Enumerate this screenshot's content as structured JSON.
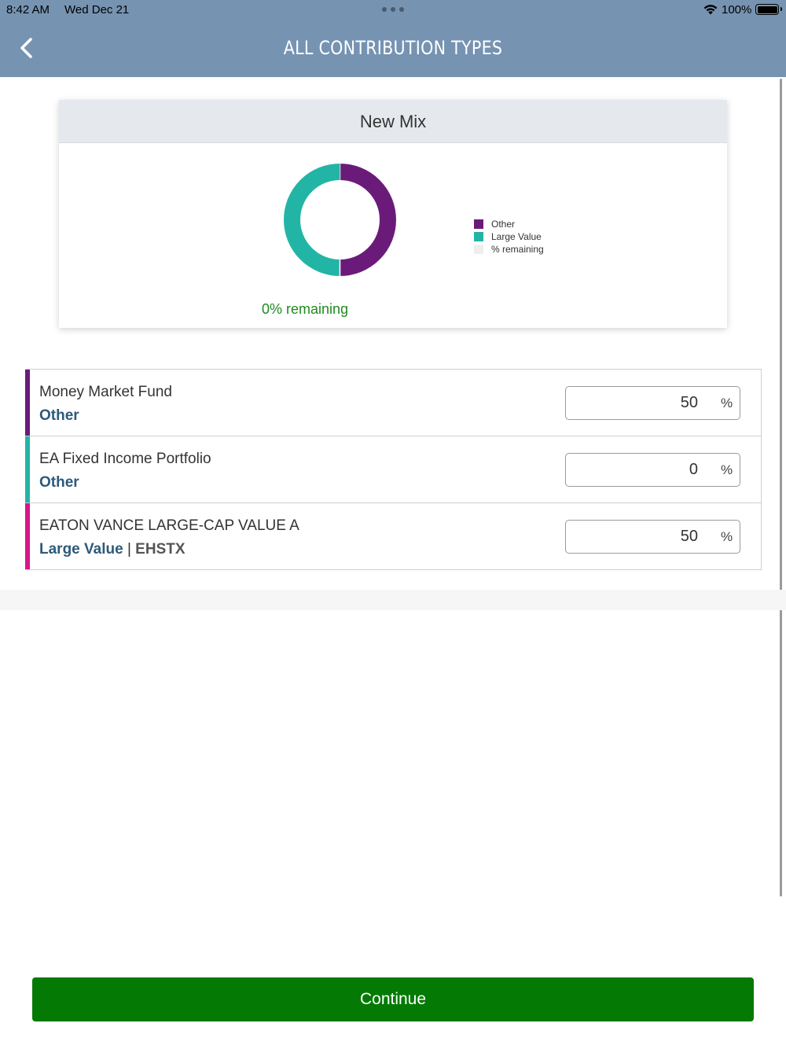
{
  "status_bar": {
    "time": "8:42 AM",
    "date": "Wed Dec 21",
    "battery_percent": "100%",
    "battery_level": 1.0
  },
  "nav": {
    "title": "ALL CONTRIBUTION TYPES",
    "back_icon": "chevron-left-icon"
  },
  "mix_card": {
    "title": "New Mix",
    "remaining_text": "0% remaining",
    "legend": [
      {
        "label": "Other",
        "color": "#6a1b7a"
      },
      {
        "label": "Large Value",
        "color": "#22b5a5"
      },
      {
        "label": "% remaining",
        "color": "#eeeeee"
      }
    ],
    "donut": [
      {
        "label": "Other",
        "value": 50,
        "color": "#6a1b7a"
      },
      {
        "label": "Large Value",
        "value": 50,
        "color": "#22b5a5"
      },
      {
        "label": "% remaining",
        "value": 0,
        "color": "#eeeeee"
      }
    ]
  },
  "funds": [
    {
      "name": "Money Market Fund",
      "category": "Other",
      "ticker": "",
      "value": "50",
      "unit": "%",
      "color": "#6a1b7a"
    },
    {
      "name": "EA Fixed Income Portfolio",
      "category": "Other",
      "ticker": "",
      "value": "0",
      "unit": "%",
      "color": "#22b5a5"
    },
    {
      "name": "EATON VANCE LARGE-CAP VALUE A",
      "category": "Large Value",
      "separator": "|",
      "ticker": "EHSTX",
      "value": "50",
      "unit": "%",
      "color": "#d6168a"
    }
  ],
  "continue_label": "Continue"
}
